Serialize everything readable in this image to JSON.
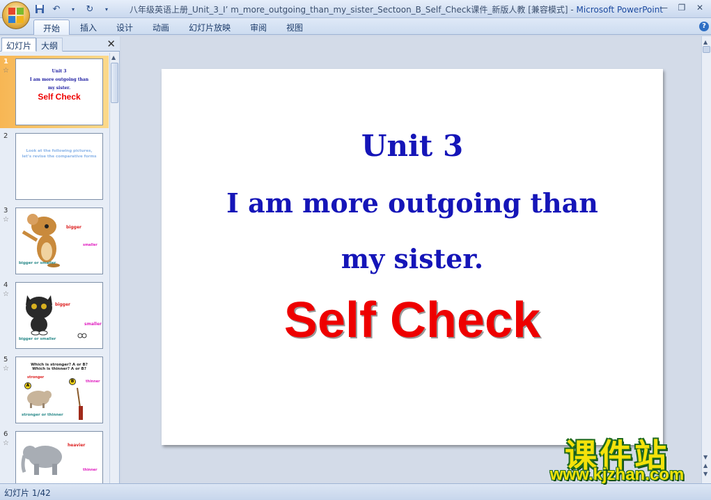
{
  "window": {
    "title": "八年级英语上册_Unit_3_I’  m_more_outgoing_than_my_sister_Sectoon_B_Self_Check课件_新版人教 [兼容模式]",
    "app_name": "Microsoft PowerPoint",
    "title_separator": " - "
  },
  "ribbon": {
    "tabs": [
      "开始",
      "插入",
      "设计",
      "动画",
      "幻灯片放映",
      "审阅",
      "视图"
    ],
    "active_tab": "开始"
  },
  "panel": {
    "tab_slides": "幻灯片",
    "tab_outline": "大纲"
  },
  "thumbnails": [
    {
      "num": "1",
      "lines": [
        "Unit 3",
        "I am more outgoing than",
        "my sister."
      ],
      "highlight": "Self Check"
    },
    {
      "num": "2",
      "lines": [
        "Look at the following pictures,",
        "let’s revise the comparative forms"
      ]
    },
    {
      "num": "3",
      "labels": [
        "bigger",
        "smaller",
        "bigger or smaller"
      ]
    },
    {
      "num": "4",
      "labels": [
        "bigger",
        "smaller",
        "bigger or smaller"
      ]
    },
    {
      "num": "5",
      "lines": [
        "Which is stronger? A or B?",
        "Which is thinner? A or B?"
      ],
      "labels": [
        "stronger",
        "thinner",
        "stronger or thinner"
      ],
      "markers": [
        "A",
        "B"
      ]
    },
    {
      "num": "6",
      "labels": [
        "heavier",
        "thinner"
      ]
    }
  ],
  "slide": {
    "unit": "Unit 3",
    "line1": "I am more outgoing than",
    "line2": "my sister.",
    "self_check": "Self Check"
  },
  "status": {
    "slide_counter": "幻灯片 1/42"
  },
  "watermark": {
    "cn": "课件站",
    "url": "www.kjzhan.com"
  },
  "colors": {
    "slide_title": "#1515b8",
    "self_check": "#ee0000",
    "selected_thumb": "#f7b654"
  }
}
